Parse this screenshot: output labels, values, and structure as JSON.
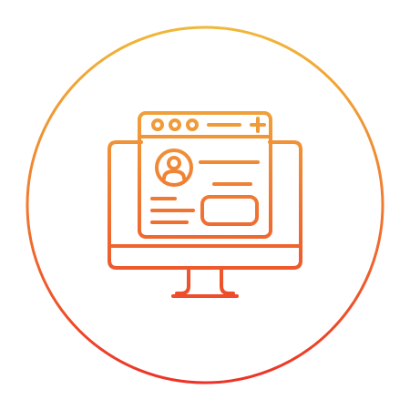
{
  "illustration": {
    "subject": "desktop-monitor-with-user-profile-webpage-icon",
    "style": "line-icon",
    "colors": {
      "gradient_top": "#F0B83A",
      "gradient_mid": "#F07A30",
      "gradient_bottom": "#EC3327",
      "background": "#FFFFFF"
    },
    "icons": [
      "outer-ring",
      "monitor-icon",
      "browser-window-icon",
      "user-avatar-icon",
      "plus-icon"
    ]
  }
}
